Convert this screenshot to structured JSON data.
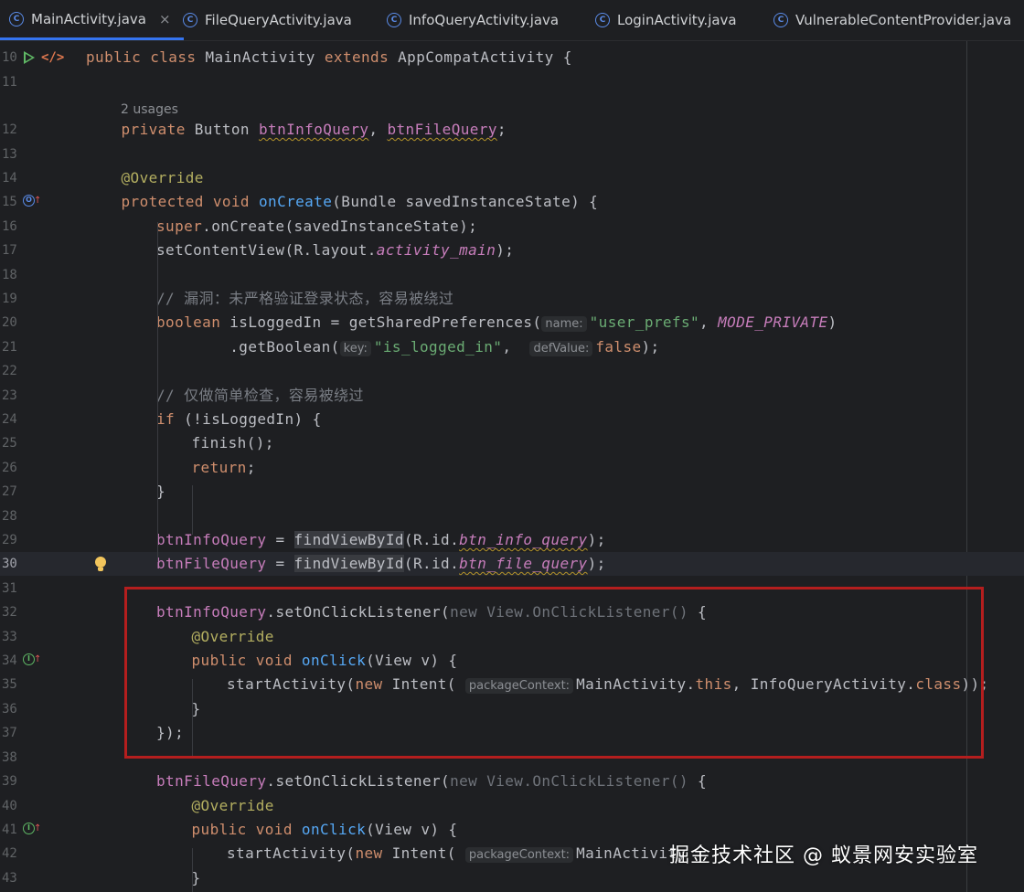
{
  "tabs": [
    {
      "label": "MainActivity.java",
      "icon": "java-class-icon",
      "icon_glyph": "C",
      "active": true,
      "close": "×"
    },
    {
      "label": "FileQueryActivity.java",
      "icon": "java-class-icon",
      "icon_glyph": "C"
    },
    {
      "label": "InfoQueryActivity.java",
      "icon": "java-class-icon",
      "icon_glyph": "C"
    },
    {
      "label": "LoginActivity.java",
      "icon": "java-class-icon",
      "icon_glyph": "C"
    },
    {
      "label": "VulnerableContentProvider.java",
      "icon": "java-class-icon",
      "icon_glyph": "C"
    }
  ],
  "gutter_icons": {
    "run": "run-icon",
    "code": "code-icon",
    "code_glyph": "</>",
    "override": "override-icon",
    "override_glyph": "O",
    "implement": "implement-icon",
    "implement_glyph": "I",
    "up_arrow": "↑",
    "bulb": "lightbulb-icon"
  },
  "usages_hint": "2 usages",
  "lines": [
    {
      "n": "10",
      "tokens": [
        {
          "t": "public class ",
          "c": "kw"
        },
        {
          "t": "MainActivity "
        },
        {
          "t": "extends ",
          "c": "kw"
        },
        {
          "t": "AppCompatActivity {"
        }
      ]
    },
    {
      "n": "11",
      "tokens": []
    },
    {
      "n": "12",
      "tokens": [
        {
          "t": "private ",
          "c": "kw"
        },
        {
          "t": "Button "
        },
        {
          "t": "btnInfoQuery",
          "c": "fld wv"
        },
        {
          "t": ", "
        },
        {
          "t": "btnFileQuery",
          "c": "fld wv"
        },
        {
          "t": ";"
        }
      ]
    },
    {
      "n": "13",
      "tokens": []
    },
    {
      "n": "14",
      "tokens": [
        {
          "t": "@Override",
          "c": "an"
        }
      ]
    },
    {
      "n": "15",
      "tokens": [
        {
          "t": "protected void ",
          "c": "kw"
        },
        {
          "t": "onCreate",
          "c": "fn"
        },
        {
          "t": "(Bundle savedInstanceState) {"
        }
      ]
    },
    {
      "n": "16",
      "tokens": [
        {
          "t": "super",
          "c": "kw"
        },
        {
          "t": ".onCreate(savedInstanceState);"
        }
      ]
    },
    {
      "n": "17",
      "tokens": [
        {
          "t": "setContentView(R.layout."
        },
        {
          "t": "activity_main",
          "c": "fld it"
        },
        {
          "t": ");"
        }
      ]
    },
    {
      "n": "18",
      "tokens": []
    },
    {
      "n": "19",
      "tokens": [
        {
          "t": "// 漏洞：未严格验证登录状态，容易被绕过",
          "c": "cm"
        }
      ]
    },
    {
      "n": "20",
      "tokens": [
        {
          "t": "boolean ",
          "c": "kw"
        },
        {
          "t": "isLoggedIn = getSharedPreferences("
        },
        {
          "t": "name:",
          "c": "hint"
        },
        {
          "t": "\"user_prefs\"",
          "c": "st"
        },
        {
          "t": ", "
        },
        {
          "t": "MODE_PRIVATE",
          "c": "fld it"
        },
        {
          "t": ")"
        }
      ]
    },
    {
      "n": "21",
      "tokens": [
        {
          "t": "        .getBoolean("
        },
        {
          "t": "key:",
          "c": "hint"
        },
        {
          "t": "\"is_logged_in\"",
          "c": "st"
        },
        {
          "t": ",  "
        },
        {
          "t": "defValue:",
          "c": "hint"
        },
        {
          "t": "false",
          "c": "kw"
        },
        {
          "t": ");"
        }
      ]
    },
    {
      "n": "22",
      "tokens": []
    },
    {
      "n": "23",
      "tokens": [
        {
          "t": "// 仅做简单检查，容易被绕过",
          "c": "cm"
        }
      ]
    },
    {
      "n": "24",
      "tokens": [
        {
          "t": "if ",
          "c": "kw"
        },
        {
          "t": "(!isLoggedIn) {"
        }
      ]
    },
    {
      "n": "25",
      "tokens": [
        {
          "t": "finish();"
        }
      ]
    },
    {
      "n": "26",
      "tokens": [
        {
          "t": "return",
          "c": "kw"
        },
        {
          "t": ";"
        }
      ]
    },
    {
      "n": "27",
      "tokens": [
        {
          "t": "}"
        }
      ]
    },
    {
      "n": "28",
      "tokens": []
    },
    {
      "n": "29",
      "tokens": [
        {
          "t": "btnInfoQuery",
          "c": "fld"
        },
        {
          "t": " = "
        },
        {
          "t": "findViewById",
          "c": "box-hl"
        },
        {
          "t": "(R.id."
        },
        {
          "t": "btn_info_query",
          "c": "fld it wv"
        },
        {
          "t": ");"
        }
      ]
    },
    {
      "n": "30",
      "tokens": [
        {
          "t": "btnFileQuery",
          "c": "fld"
        },
        {
          "t": " = "
        },
        {
          "t": "findViewById",
          "c": "box-hl"
        },
        {
          "t": "(R.id."
        },
        {
          "t": "btn_file_query",
          "c": "fld it wv"
        },
        {
          "t": ");"
        }
      ]
    },
    {
      "n": "31",
      "tokens": []
    },
    {
      "n": "32",
      "tokens": [
        {
          "t": "btnInfoQuery",
          "c": "fld"
        },
        {
          "t": ".setOnClickListener("
        },
        {
          "t": "new ",
          "c": "gr"
        },
        {
          "t": "View.OnClickListener()",
          "c": "gr"
        },
        {
          "t": " {"
        }
      ]
    },
    {
      "n": "33",
      "tokens": [
        {
          "t": "@Override",
          "c": "an"
        }
      ]
    },
    {
      "n": "34",
      "tokens": [
        {
          "t": "public void ",
          "c": "kw"
        },
        {
          "t": "onClick",
          "c": "fn"
        },
        {
          "t": "(View v) {"
        }
      ]
    },
    {
      "n": "35",
      "tokens": [
        {
          "t": "startActivity("
        },
        {
          "t": "new ",
          "c": "kw"
        },
        {
          "t": "Intent( "
        },
        {
          "t": "packageContext:",
          "c": "hint"
        },
        {
          "t": "MainActivity."
        },
        {
          "t": "this",
          "c": "kw"
        },
        {
          "t": ", InfoQueryActivity."
        },
        {
          "t": "class",
          "c": "kw"
        },
        {
          "t": "));"
        }
      ]
    },
    {
      "n": "36",
      "tokens": [
        {
          "t": "}"
        }
      ]
    },
    {
      "n": "37",
      "tokens": [
        {
          "t": "});"
        }
      ]
    },
    {
      "n": "38",
      "tokens": []
    },
    {
      "n": "39",
      "tokens": [
        {
          "t": "btnFileQuery",
          "c": "fld"
        },
        {
          "t": ".setOnClickListener("
        },
        {
          "t": "new ",
          "c": "gr"
        },
        {
          "t": "View.OnClickListener()",
          "c": "gr"
        },
        {
          "t": " {"
        }
      ]
    },
    {
      "n": "40",
      "tokens": [
        {
          "t": "@Override",
          "c": "an"
        }
      ]
    },
    {
      "n": "41",
      "tokens": [
        {
          "t": "public void ",
          "c": "kw"
        },
        {
          "t": "onClick",
          "c": "fn"
        },
        {
          "t": "(View v) {"
        }
      ]
    },
    {
      "n": "42",
      "tokens": [
        {
          "t": "startActivity("
        },
        {
          "t": "new ",
          "c": "kw"
        },
        {
          "t": "Intent( "
        },
        {
          "t": "packageContext:",
          "c": "hint"
        },
        {
          "t": "MainActivity"
        }
      ]
    },
    {
      "n": "43",
      "tokens": [
        {
          "t": "}"
        }
      ]
    }
  ],
  "watermark": "掘金技术社区 @ 蚁景网安实验室",
  "colors": {
    "background": "#1e1f22",
    "keyword": "#cf8e6d",
    "function": "#56a8f5",
    "annotation": "#b3ae60",
    "string": "#6aab73",
    "field": "#c77dbb",
    "comment": "#7a7e85",
    "highlight_box": "#b41e1e",
    "active_tab": "#3574f0"
  }
}
